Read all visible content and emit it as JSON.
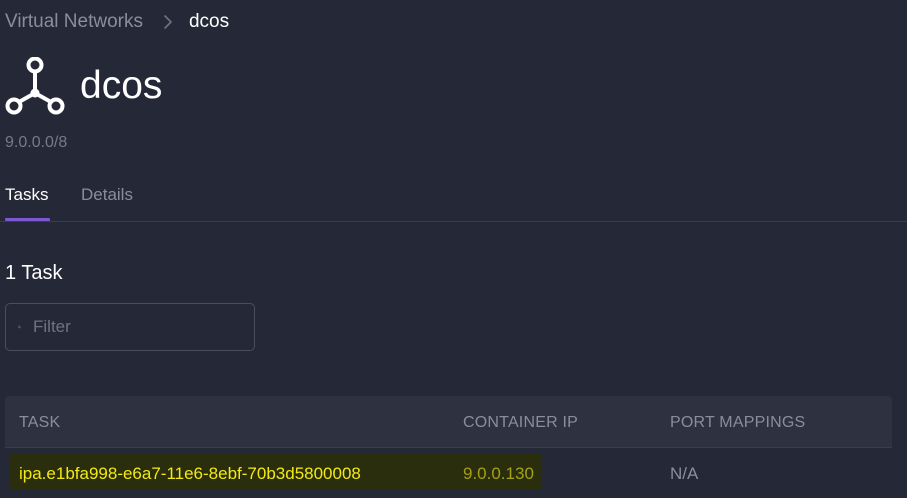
{
  "breadcrumb": {
    "root": "Virtual Networks",
    "current": "dcos"
  },
  "header": {
    "icon": "network-icon",
    "title": "dcos",
    "subnet": "9.0.0.0/8"
  },
  "tabs": [
    {
      "label": "Tasks",
      "active": true
    },
    {
      "label": "Details",
      "active": false
    }
  ],
  "task_count": "1 Task",
  "filter": {
    "placeholder": "Filter",
    "value": "",
    "icon": "search-icon"
  },
  "table": {
    "columns": [
      "TASK",
      "CONTAINER IP",
      "PORT MAPPINGS"
    ],
    "rows": [
      {
        "task": "ipa.e1bfa998-e6a7-11e6-8ebf-70b3d5800008",
        "container_ip": "9.0.0.130",
        "port_mappings": "N/A"
      }
    ]
  },
  "colors": {
    "background": "#252837",
    "accent": "#7e57d4",
    "highlight_text": "#f2ea12",
    "muted_text": "#8b8d9a"
  }
}
